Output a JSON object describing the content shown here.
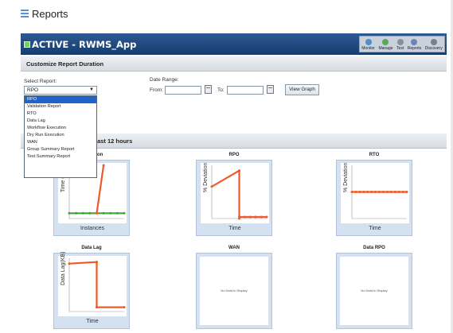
{
  "page": {
    "title": "Reports"
  },
  "app_bar": {
    "title": "ACTIVE - RWMS_App",
    "toolbar": [
      {
        "label": "Monitor",
        "icon": "monitor-icon",
        "color": "#4f8fcf"
      },
      {
        "label": "Manage",
        "icon": "manage-icon",
        "color": "#5aa85a"
      },
      {
        "label": "Test",
        "icon": "test-icon",
        "color": "#8a8f9a"
      },
      {
        "label": "Reports",
        "icon": "reports-icon",
        "color": "#6d86b8"
      },
      {
        "label": "Discovery",
        "icon": "discovery-icon",
        "color": "#7b7f87"
      }
    ]
  },
  "customize": {
    "header": "Customize Report Duration",
    "select_label": "Select Report:",
    "selected_report": "RPO",
    "date_range_label": "Date Range:",
    "from_label": "From:",
    "to_label": "To:",
    "from_value": "",
    "to_value": "",
    "view_button": "View Graph"
  },
  "dropdown_options": [
    "RPO",
    "Validation Report",
    "RTO",
    "Data Lag",
    "Workflow Execution",
    "Dry Run Execution",
    "WAN",
    "Group Summary Report",
    "Test Summary Report"
  ],
  "results": {
    "header_prefix": "",
    "header": "last 12 hours"
  },
  "colors": {
    "series_orange": "#f05a28",
    "series_green": "#3aa63a",
    "frame_bg": "#d4e1f1",
    "app_bar": "#1f487c"
  },
  "chart_data": [
    {
      "type": "line",
      "title": "Workflow Execution",
      "title_visible": "Execution",
      "ylabel": "Time (minutes)",
      "xlabel": "Instances",
      "series": [
        {
          "color": "#3aa63a",
          "x": [
            0,
            1,
            2,
            3,
            4,
            5,
            6,
            7,
            8
          ],
          "values": [
            1,
            1,
            1,
            1,
            1,
            1,
            1,
            1,
            1
          ]
        },
        {
          "color": "#f05a28",
          "x": [
            4,
            5
          ],
          "values": [
            1,
            10
          ]
        }
      ],
      "xlim": [
        0,
        8
      ],
      "ylim": [
        0,
        10
      ]
    },
    {
      "type": "line",
      "title": "RPO",
      "ylabel": "% Deviation",
      "xlabel": "Time",
      "series": [
        {
          "color": "#f05a28",
          "x": [
            0,
            5
          ],
          "values": [
            6,
            9
          ]
        },
        {
          "color": "#f05a28",
          "x": [
            5,
            5
          ],
          "values": [
            9,
            0
          ]
        },
        {
          "color": "#f05a28",
          "x": [
            5,
            6,
            7,
            8,
            9,
            10
          ],
          "values": [
            0.3,
            0.3,
            0.3,
            0.3,
            0.3,
            0.3
          ]
        }
      ],
      "xlim": [
        0,
        10
      ],
      "ylim": [
        0,
        10
      ]
    },
    {
      "type": "line",
      "title": "RTO",
      "ylabel": "% Deviation",
      "xlabel": "Time",
      "series": [
        {
          "color": "#f05a28",
          "x": [
            0,
            1,
            2,
            3,
            4,
            5,
            6,
            7,
            8,
            9,
            10,
            11,
            12,
            13,
            14
          ],
          "values": [
            5,
            5,
            5,
            5,
            5,
            5,
            5,
            5,
            5,
            5,
            5,
            5,
            5,
            5,
            5
          ]
        }
      ],
      "xlim": [
        0,
        14
      ],
      "ylim": [
        0,
        10
      ]
    },
    {
      "type": "line",
      "title": "Data Lag",
      "ylabel": "Data Lag(KB)",
      "xlabel": "Time",
      "series": [
        {
          "color": "#f05a28",
          "x": [
            0,
            5
          ],
          "values": [
            9,
            9.3
          ]
        },
        {
          "color": "#f05a28",
          "x": [
            5,
            5
          ],
          "values": [
            9.3,
            0.8
          ]
        },
        {
          "color": "#f05a28",
          "x": [
            5,
            10
          ],
          "values": [
            0.8,
            0.8
          ]
        }
      ],
      "xlim": [
        0,
        10
      ],
      "ylim": [
        0,
        10
      ]
    },
    {
      "type": "line",
      "title": "WAN",
      "series": [],
      "no_data": "No Data to Display"
    },
    {
      "type": "line",
      "title": "Data RPO",
      "series": [],
      "no_data": "No Data to Display"
    }
  ]
}
